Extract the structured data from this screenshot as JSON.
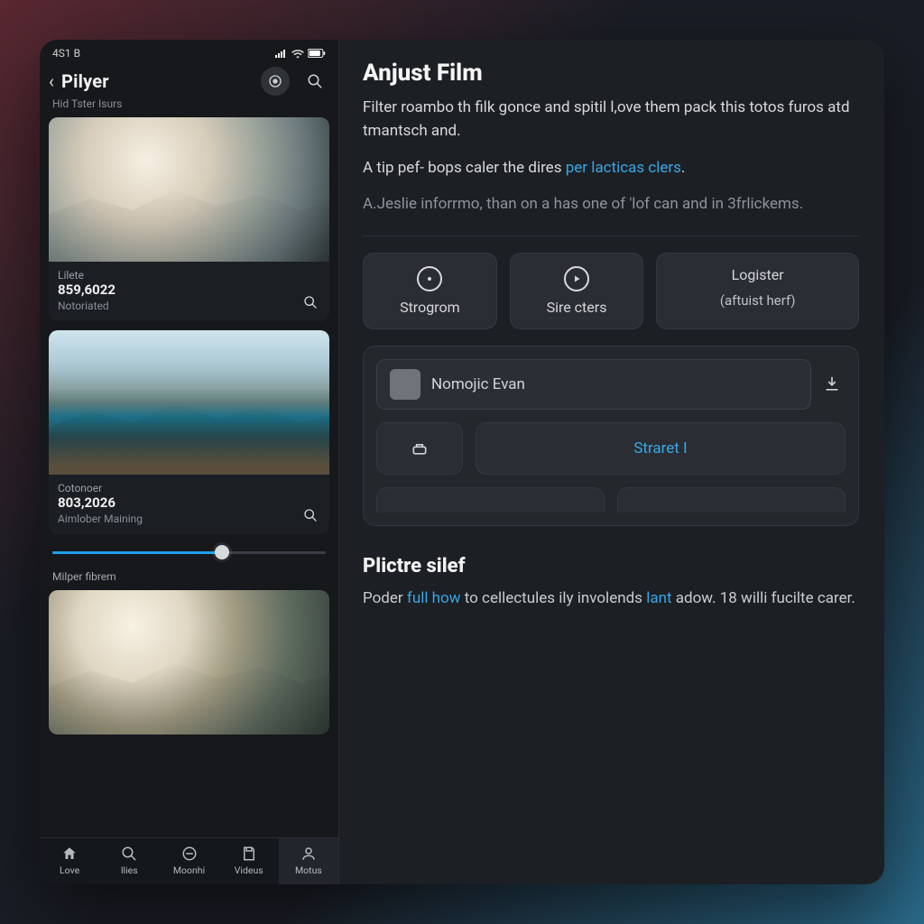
{
  "statusbar": {
    "time": "4S1 B"
  },
  "appbar": {
    "title": "Pilyer",
    "subhead": "Hid Tster Isurs"
  },
  "gallery": [
    {
      "label": "Lilete",
      "value": "859,6022",
      "sub": "Notoriated"
    },
    {
      "label": "Cotonoer",
      "value": "803,2026",
      "sub": "Aimlober Maining"
    }
  ],
  "slider": {
    "label": "Milper fibrem",
    "percent": 62
  },
  "tabs": [
    {
      "label": "Love"
    },
    {
      "label": "llies"
    },
    {
      "label": "Moonhi"
    },
    {
      "label": "Videus"
    },
    {
      "label": "Motus"
    }
  ],
  "right": {
    "title": "Anjust Film",
    "p1": "Filter roambo th filk gonce and spitil l,ove them pack this totos furos atd tmantsch and.",
    "p2_a": "A tip pef- bops caler the dires ",
    "p2_link": "per lacticas clers",
    "p2_b": ".",
    "p3": "A.Jeslie inforrmo, than on a has one of 'lof can and in 3frlickems.",
    "pill1": "Strogrom",
    "pill2": "Sire cters",
    "pill3_a": "Logister",
    "pill3_b": "(aftuist herf)",
    "input_placeholder": "Nomojic Evan",
    "chip_link": "Straret I",
    "section_title": "Plictre silef",
    "section_p_a": "Poder ",
    "section_link1": "full how",
    "section_p_b": " to cellectules ily involends ",
    "section_link2": "lant",
    "section_p_c": " adow. 18 willi fucilte carer."
  }
}
